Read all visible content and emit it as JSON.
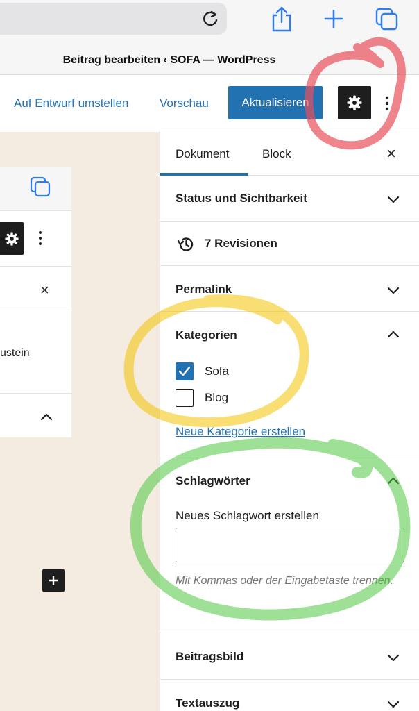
{
  "browser": {
    "page_title": "Beitrag bearbeiten ‹ SOFA — WordPress"
  },
  "header": {
    "draft_link": "Auf Entwurf umstellen",
    "preview_link": "Vorschau",
    "update_button": "Aktualisieren"
  },
  "editor": {
    "inner_text": "ustein",
    "inner_close": "×",
    "add_block": "+"
  },
  "sidebar": {
    "tabs": [
      {
        "label": "Dokument"
      },
      {
        "label": "Block"
      }
    ],
    "close": "×",
    "panels": {
      "status": "Status und Sichtbarkeit",
      "revisions": "7 Revisionen",
      "permalink": "Permalink",
      "categories": "Kategorien",
      "tags": "Schlagwörter",
      "featured_image": "Beitragsbild",
      "excerpt": "Textauszug"
    },
    "categories": [
      {
        "label": "Sofa",
        "checked": true
      },
      {
        "label": "Blog",
        "checked": false
      }
    ],
    "new_category_link": "Neue Kategorie erstellen",
    "tags": {
      "label": "Neues Schlagwort erstellen",
      "value": "",
      "help": "Mit Kommas oder der Eingabetaste trennen."
    }
  },
  "colors": {
    "accent": "#2271b1",
    "canvas": "#f4ece0",
    "annotation_red": "#e8505b",
    "annotation_yellow": "#f2c200",
    "annotation_green": "#4fc93f"
  }
}
